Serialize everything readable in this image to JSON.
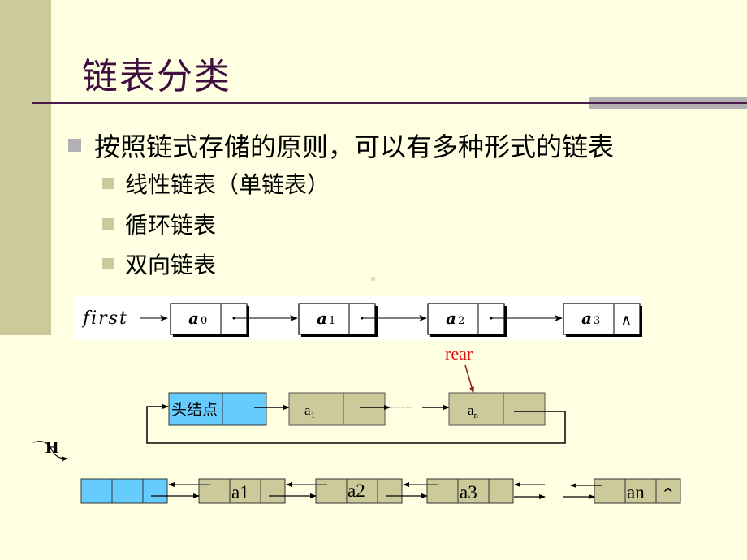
{
  "slide": {
    "title": "链表分类",
    "bullet_main": "按照链式存储的原则，可以有多种形式的链表",
    "sub_bullets": [
      "线性链表（单链表）",
      "循环链表",
      "双向链表"
    ]
  },
  "colors": {
    "background": "#FFFFE1",
    "sidebar": "#CCCA9A",
    "title": "#3F0F3F",
    "node_fill": "#CCCA9A",
    "head_fill": "#66CCFF",
    "rear_label": "#DD1111",
    "rear_arrow": "#8B1A1A"
  },
  "singly_list": {
    "head_label": "first",
    "nodes": [
      {
        "data": "a",
        "sub": "0"
      },
      {
        "data": "a",
        "sub": "1"
      },
      {
        "data": "a",
        "sub": "2"
      },
      {
        "data": "a",
        "sub": "3",
        "null_link": "∧"
      }
    ]
  },
  "circular_list": {
    "head_node_label": "头结点",
    "nodes": [
      {
        "data": "a",
        "sub": "1"
      },
      {
        "data": "a",
        "sub": "n"
      }
    ],
    "rear_label": "rear"
  },
  "doubly_list": {
    "head_label": "H",
    "nodes": [
      "a1",
      "a2",
      "a3",
      "an"
    ],
    "null_link": "^"
  }
}
